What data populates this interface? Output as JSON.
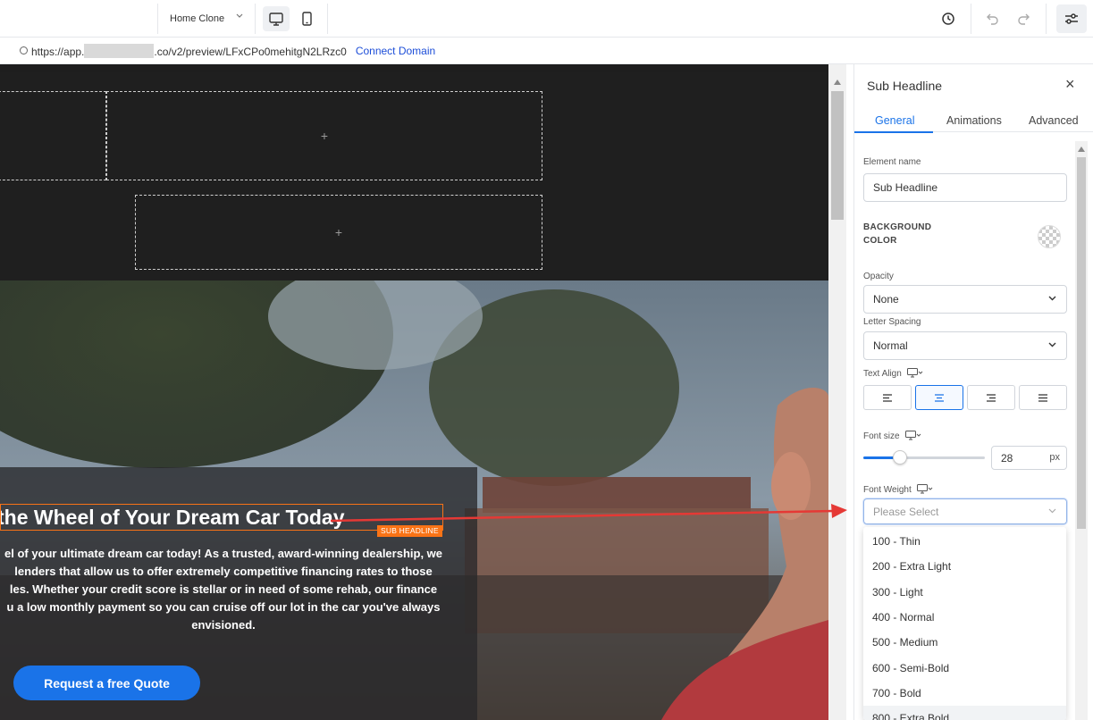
{
  "topbar": {
    "page_name": "Home Clone",
    "icons": [
      "desktop-icon",
      "mobile-icon",
      "history-icon",
      "undo-icon",
      "redo-icon",
      "settings-sliders-icon"
    ]
  },
  "urlbar": {
    "url_prefix": "https://app.",
    "url_suffix": ".co/v2/preview/LFxCPo0mehitgN2LRzc0",
    "connect_label": "Connect Domain"
  },
  "canvas": {
    "plus_1": "+",
    "plus_2": "+",
    "hero": {
      "headline": "the Wheel of Your Dream Car Today",
      "element_tag": "SUB HEADLINE",
      "body_lines": [
        "el of your ultimate dream car today! As a trusted, award-winning dealership, we",
        "lenders that allow us to offer extremely competitive financing rates to those",
        "les. Whether your credit score is stellar or in need of some rehab, our finance",
        "u a low monthly payment so you can cruise off our lot in the car you've always",
        "envisioned."
      ],
      "cta_label": "Request a free Quote"
    }
  },
  "panel": {
    "title": "Sub Headline",
    "close": "×",
    "tabs": [
      "General",
      "Animations",
      "Advanced"
    ],
    "active_tab": "General",
    "element_name_label": "Element name",
    "element_name_value": "Sub Headline",
    "bg_color_label_1": "BACKGROUND",
    "bg_color_label_2": "COLOR",
    "opacity_label": "Opacity",
    "opacity_value": "None",
    "letter_spacing_label": "Letter Spacing",
    "letter_spacing_value": "Normal",
    "text_align_label": "Text Align",
    "text_align_selected": "center",
    "font_size_label": "Font size",
    "font_size_value": "28",
    "font_size_unit": "px",
    "font_size_slider_fraction": 0.3,
    "font_weight_label": "Font Weight",
    "font_weight_placeholder": "Please Select",
    "font_weight_options": [
      "100 - Thin",
      "200 - Extra Light",
      "300 - Light",
      "400 - Normal",
      "500 - Medium",
      "600 - Semi-Bold",
      "700 - Bold",
      "800 - Extra Bold"
    ]
  },
  "colors": {
    "accent": "#1a73e8",
    "selection_outline": "#f97316",
    "annotation_arrow": "#e53935",
    "canvas_dark": "#1f1f1f"
  }
}
